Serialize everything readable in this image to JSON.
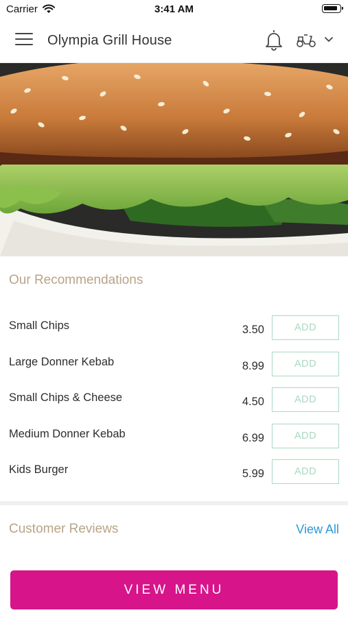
{
  "status_bar": {
    "carrier": "Carrier",
    "time": "3:41 AM"
  },
  "header": {
    "title": "Olympia Grill House",
    "icons": [
      "menu-icon",
      "bell-icon",
      "scooter-icon",
      "chevron-down-icon"
    ]
  },
  "hero": {
    "image": "burger-photo"
  },
  "recommendations": {
    "title": "Our Recommendations",
    "add_label": "ADD",
    "items": [
      {
        "name": "Small Chips",
        "price": "3.50"
      },
      {
        "name": "Large Donner Kebab",
        "price": "8.99"
      },
      {
        "name": "Small Chips & Cheese",
        "price": "4.50"
      },
      {
        "name": "Medium Donner Kebab",
        "price": "6.99"
      },
      {
        "name": "Kids Burger",
        "price": "5.99"
      }
    ]
  },
  "reviews": {
    "title": "Customer Reviews",
    "view_all": "View All"
  },
  "cta": {
    "label": "VIEW MENU"
  },
  "colors": {
    "accent": "#d7148a",
    "section_title": "#b8a487",
    "add_border": "#a8d9c1",
    "link": "#2b9ad8"
  }
}
